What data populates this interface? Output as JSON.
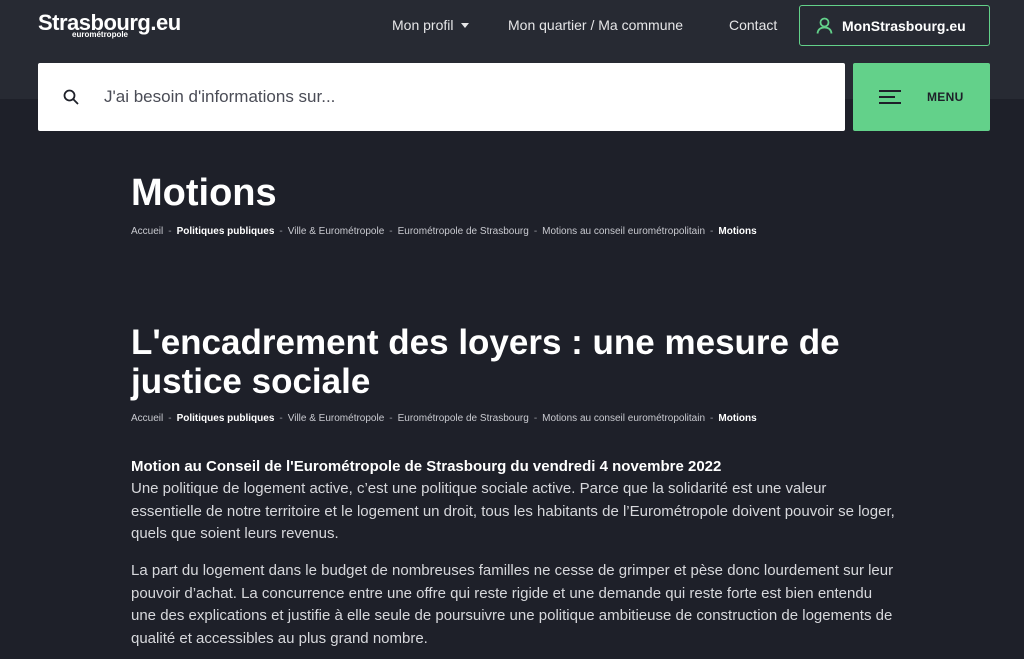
{
  "header": {
    "logo_main": "Strasbourg.eu",
    "logo_sub": "eurométropole",
    "nav": {
      "profil": "Mon profil",
      "quartier": "Mon quartier / Ma commune",
      "contact": "Contact"
    },
    "account_button": "MonStrasbourg.eu"
  },
  "search": {
    "placeholder": "J'ai besoin d'informations sur...",
    "value": ""
  },
  "menu": {
    "label": "MENU"
  },
  "page": {
    "title": "Motions"
  },
  "breadcrumb": [
    {
      "label": "Accueil",
      "bold": false
    },
    {
      "label": "Politiques publiques",
      "bold": true
    },
    {
      "label": "Ville & Eurométropole",
      "bold": false
    },
    {
      "label": "Eurométropole de Strasbourg",
      "bold": false
    },
    {
      "label": "Motions au conseil eurométropolitain",
      "bold": false
    },
    {
      "label": "Motions",
      "bold": true
    }
  ],
  "breadcrumb_separator": "-",
  "article": {
    "title": "L'encadrement des loyers : une mesure de justice sociale",
    "motion_heading": "Motion au Conseil de l'Eurométropole de Strasbourg du vendredi 4 novembre 2022",
    "paragraphs": [
      "Une politique de logement active, c’est une politique sociale active. Parce que la solidarité est une valeur essentielle de notre territoire et le logement un droit, tous les habitants de l’Eurométropole doivent pouvoir se loger, quels que soient leurs revenus.",
      "La part du logement dans le budget de nombreuses familles ne cesse de grimper et pèse donc lourdement sur leur pouvoir d’achat. La concurrence entre une offre qui reste rigide et une demande qui reste forte est bien entendu une des explications et justifie à elle seule de poursuivre une politique ambitieuse de construction de logements de qualité et accessibles au plus grand nombre."
    ]
  },
  "colors": {
    "background": "#1e2029",
    "header_bg": "#272a33",
    "accent": "#63d18a"
  }
}
